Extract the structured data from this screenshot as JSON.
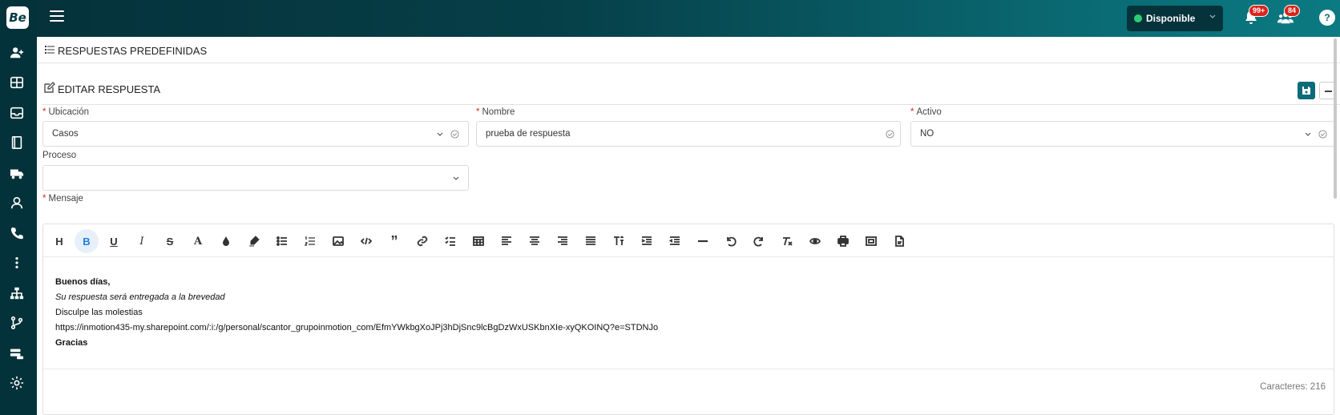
{
  "app": {
    "logo_text": "Be"
  },
  "sidebar": {
    "items": [
      {
        "icon": "add-user-icon"
      },
      {
        "icon": "grid-icon"
      },
      {
        "icon": "inbox-icon"
      },
      {
        "icon": "book-icon"
      },
      {
        "icon": "truck-icon"
      },
      {
        "icon": "user-icon"
      },
      {
        "icon": "phone-icon"
      },
      {
        "icon": "more-vertical-icon"
      },
      {
        "icon": "sitemap-icon"
      },
      {
        "icon": "branch-icon"
      },
      {
        "icon": "server-icon"
      },
      {
        "icon": "gear-icon"
      }
    ]
  },
  "topbar": {
    "status_label": "Disponible",
    "notifications_badge": "99+",
    "users_badge": "84",
    "help_label": "?"
  },
  "page": {
    "title": "RESPUESTAS PREDEFINIDAS",
    "section_title": "EDITAR RESPUESTA"
  },
  "form": {
    "ubicacion": {
      "label": "Ubicación",
      "value": "Casos",
      "required": true
    },
    "nombre": {
      "label": "Nombre",
      "value": "prueba de respuesta",
      "required": true
    },
    "activo": {
      "label": "Activo",
      "value": "NO",
      "required": true
    },
    "proceso": {
      "label": "Proceso",
      "value": ""
    },
    "mensaje": {
      "label": "Mensaje",
      "required": true
    }
  },
  "editor": {
    "toolbar": [
      "H",
      "B",
      "U",
      "I",
      "S",
      "A",
      "color",
      "highlight",
      "ul",
      "ol",
      "image",
      "code",
      "quote",
      "link",
      "checklist",
      "table",
      "align-left",
      "align-center",
      "align-right",
      "justify",
      "text-size",
      "indent",
      "outdent",
      "hr",
      "undo",
      "redo",
      "clear-format",
      "preview",
      "print",
      "fullscreen",
      "export"
    ],
    "content": {
      "line1": "Buenos días,",
      "line2": "Su respuesta será entregada a la brevedad",
      "line3": "Disculpe las molestias",
      "line4": "https://inmotion435-my.sharepoint.com/:i:/g/personal/scantor_grupoinmotion_com/EfmYWkbgXoJPj3hDjSnc9lcBgDzWxUSKbnXIe-xyQKOINQ?e=STDNJo",
      "line5": "Gracias"
    },
    "char_count": "Caracteres: 216"
  },
  "colors": {
    "accent": "#0b6b78",
    "sidebar": "#04323a",
    "required": "#d9251c",
    "status_dot": "#2ecc71"
  }
}
